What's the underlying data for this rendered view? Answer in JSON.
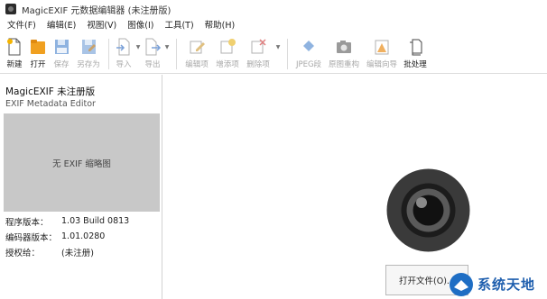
{
  "window": {
    "title": "MagicEXIF 元数据编辑器 (未注册版)"
  },
  "menu": [
    {
      "label": "文件(F)"
    },
    {
      "label": "编辑(E)"
    },
    {
      "label": "视图(V)"
    },
    {
      "label": "图像(I)"
    },
    {
      "label": "工具(T)"
    },
    {
      "label": "帮助(H)"
    }
  ],
  "toolbar": {
    "new": "新建",
    "open": "打开",
    "save": "保存",
    "save_as": "另存为",
    "import": "导入",
    "export": "导出",
    "edit_item": "编辑项",
    "add_item": "增添项",
    "delete_item": "删除项",
    "jpeg_section": "JPEG段",
    "original_rebuild": "原图重构",
    "edit_wizard": "编辑向导",
    "batch": "批处理"
  },
  "left_panel": {
    "title": "MagicEXIF 未注册版",
    "subtitle": "EXIF Metadata Editor",
    "thumbnail_text": "无 EXIF 缩略图",
    "info": [
      {
        "key": "程序版本：",
        "value": "1.03 Build 0813"
      },
      {
        "key": "编码器版本：",
        "value": "1.01.0280"
      },
      {
        "key": "授权给：",
        "value": "(未注册)"
      }
    ]
  },
  "main": {
    "open_button": "打开文件(O)..."
  },
  "watermark": {
    "text": "系统天地"
  }
}
